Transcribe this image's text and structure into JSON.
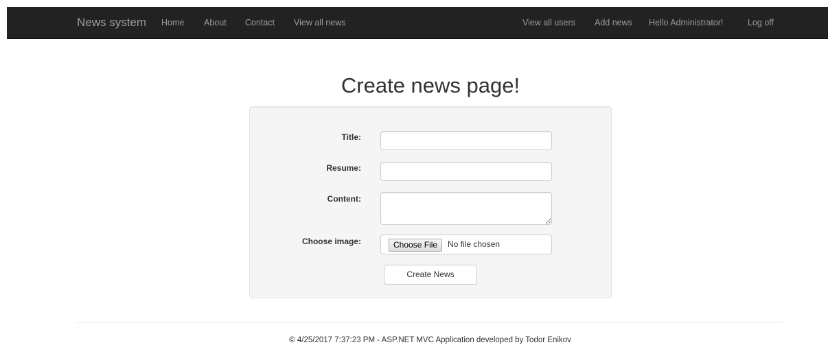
{
  "navbar": {
    "brand": "News system",
    "left_links": [
      "Home",
      "About",
      "Contact",
      "View all news"
    ],
    "right_links": [
      "View all users",
      "Add news",
      "Hello Administrator!",
      "Log off"
    ]
  },
  "page": {
    "title": "Create news page!"
  },
  "form": {
    "title_label": "Title:",
    "title_value": "",
    "resume_label": "Resume:",
    "resume_value": "",
    "content_label": "Content:",
    "content_value": "",
    "image_label": "Choose image:",
    "file_button": "Choose File",
    "file_status": "No file chosen",
    "submit_label": "Create News"
  },
  "footer": {
    "text": "© 4/25/2017 7:37:23 PM - ASP.NET MVC Application developed by Todor Enikov"
  }
}
